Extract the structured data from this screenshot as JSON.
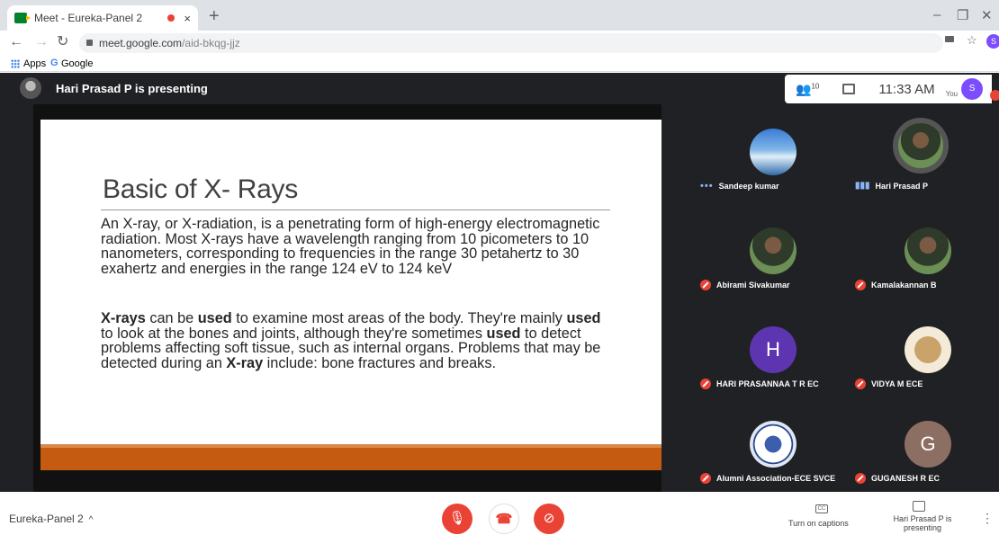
{
  "browser": {
    "tab_title": "Meet - Eureka-Panel 2",
    "tab_close": "×",
    "new_tab": "+",
    "url_domain": "meet.google.com",
    "url_path": "/aid-bkqg-jjz",
    "bookmarks": [
      "Apps",
      "Google"
    ],
    "window_controls": [
      "–",
      "❐",
      "✕"
    ],
    "profile_initial": "S"
  },
  "meet": {
    "presenting_text": "Hari Prasad P is presenting",
    "people_count": "10",
    "clock": "11:33 AM",
    "you_label": "You",
    "user_initial": "S",
    "meeting_name": "Eureka-Panel 2",
    "captions_label": "Turn on captions",
    "captions_icon_text": "CC",
    "present_label": "Hari Prasad P is presenting"
  },
  "slide": {
    "title": "Basic of X- Rays",
    "para1": "An X-ray, or X-radiation, is a penetrating form of high-energy electromagnetic radiation. Most X-rays have a wavelength ranging from 10 picometers to 10 nanometers, corresponding to frequencies in the range 30 petahertz to 30 exahertz and energies in the range 124 eV to 124 keV",
    "para2_parts": [
      {
        "text": "X-rays",
        "bold": true
      },
      {
        "text": " can be ",
        "bold": false
      },
      {
        "text": "used",
        "bold": true
      },
      {
        "text": " to examine most areas of the body. They're mainly ",
        "bold": false
      },
      {
        "text": "used",
        "bold": true
      },
      {
        "text": " to look at the bones and joints, although they're sometimes ",
        "bold": false
      },
      {
        "text": "used",
        "bold": true
      },
      {
        "text": " to detect problems affecting soft tissue, such as internal organs. Problems that may be detected during an ",
        "bold": false
      },
      {
        "text": "X-ray",
        "bold": true
      },
      {
        "text": " include: bone fractures and breaks.",
        "bold": false
      }
    ]
  },
  "participants": [
    {
      "name": "Sandeep kumar",
      "status": "speaking-dots",
      "avatar": "landscape"
    },
    {
      "name": "Hari Prasad P",
      "status": "speaking-bars",
      "avatar": "photo"
    },
    {
      "name": "Abirami Sivakumar",
      "status": "muted",
      "avatar": "photo"
    },
    {
      "name": "Kamalakannan B",
      "status": "muted",
      "avatar": "photo"
    },
    {
      "name": "HARI PRASANNAA T R EC",
      "status": "muted",
      "avatar": "letter",
      "letter": "H",
      "color": "#5e35b1"
    },
    {
      "name": "VIDYA M ECE",
      "status": "muted",
      "avatar": "ganesha"
    },
    {
      "name": "Alumni Association-ECE SVCE",
      "status": "muted",
      "avatar": "emblem"
    },
    {
      "name": "GUGANESH R EC",
      "status": "muted",
      "avatar": "letter",
      "letter": "G",
      "color": "#8d6e63"
    }
  ],
  "colors": {
    "meet_bg": "#202124",
    "mute_red": "#ea4335",
    "slide_band": "#c55a11"
  }
}
